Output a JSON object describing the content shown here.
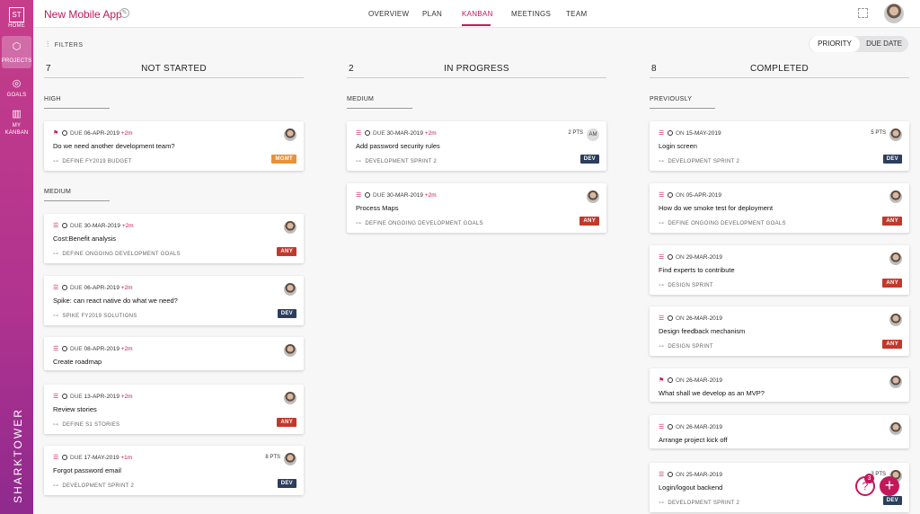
{
  "sidebar": {
    "logo": "ST",
    "home": "HOME",
    "projects": "PROJECTS",
    "goals": "GOALS",
    "my_kanban_1": "MY",
    "my_kanban_2": "KANBAN",
    "brand": "SHARKTOWER"
  },
  "topbar": {
    "title": "New Mobile App",
    "nav": [
      "OVERVIEW",
      "PLAN",
      "KANBAN",
      "MEETINGS",
      "TEAM"
    ]
  },
  "toolbar": {
    "filters": "FILTERS",
    "sort_priority": "PRIORITY",
    "sort_due": "DUE DATE"
  },
  "columns": [
    {
      "count": "7",
      "title": "NOT STARTED"
    },
    {
      "count": "2",
      "title": "IN PROGRESS"
    },
    {
      "count": "8",
      "title": "COMPLETED"
    }
  ],
  "groups": [
    "HIGH",
    "MEDIUM",
    "MEDIUM",
    "PREVIOUSLY"
  ],
  "colors": {
    "accent": "#c2185b",
    "mgmt": "#e8913a",
    "any": "#c0392b",
    "dev": "#2c3e5c"
  },
  "cards": [
    {
      "icon": "flag-icon",
      "prefix": "DUE",
      "date": "06-APR-2019",
      "delta": "+2m",
      "title": "Do we need another development team?",
      "goal": "DEFINE FY2019 BUDGET",
      "tag": "MGMT",
      "pts": ""
    },
    {
      "icon": "list-icon",
      "prefix": "DUE",
      "date": "30-MAR-2019",
      "delta": "+2m",
      "title": "Cost:Benefit analysis",
      "goal": "DEFINE ONGOING DEVELOPMENT GOALS",
      "tag": "ANY",
      "pts": ""
    },
    {
      "icon": "list-icon",
      "prefix": "DUE",
      "date": "06-APR-2019",
      "delta": "+2m",
      "title": "Spike: can react native do what we need?",
      "goal": "SPIKE FY2019 SOLUTIONS",
      "tag": "DEV",
      "pts": ""
    },
    {
      "icon": "list-icon",
      "prefix": "DUE",
      "date": "08-APR-2019",
      "delta": "+2m",
      "title": "Create roadmap",
      "goal": "",
      "tag": "",
      "pts": ""
    },
    {
      "icon": "list-icon",
      "prefix": "DUE",
      "date": "13-APR-2019",
      "delta": "+2m",
      "title": "Review stories",
      "goal": "DEFINE S1 STORIES",
      "tag": "ANY",
      "pts": ""
    },
    {
      "icon": "list-icon",
      "prefix": "DUE",
      "date": "17-MAY-2019",
      "delta": "+1m",
      "title": "Forgot password email",
      "goal": "DEVELOPMENT SPRINT 2",
      "tag": "DEV",
      "pts": "8 PTS"
    },
    {
      "icon": "list-icon",
      "prefix": "DUE",
      "date": "30-MAR-2019",
      "delta": "+2m",
      "title": "Add password security rules",
      "goal": "DEVELOPMENT SPRINT 2",
      "tag": "DEV",
      "pts": "2 PTS",
      "initials": "AM"
    },
    {
      "icon": "list-icon",
      "prefix": "DUE",
      "date": "30-MAR-2019",
      "delta": "+2m",
      "title": "Process Maps",
      "goal": "DEFINE ONGOING DEVELOPMENT GOALS",
      "tag": "ANY",
      "pts": ""
    },
    {
      "icon": "list-icon",
      "prefix": "ON",
      "date": "15-MAY-2019",
      "delta": "",
      "title": "Login screen",
      "goal": "DEVELOPMENT SPRINT 2",
      "tag": "DEV",
      "pts": "5 PTS"
    },
    {
      "icon": "list-icon",
      "prefix": "ON",
      "date": "05-APR-2019",
      "delta": "",
      "title": "How do we smoke test for deployment",
      "goal": "DEFINE ONGOING DEVELOPMENT GOALS",
      "tag": "ANY",
      "pts": ""
    },
    {
      "icon": "list-icon",
      "prefix": "ON",
      "date": "29-MAR-2019",
      "delta": "",
      "title": "Find experts to contribute",
      "goal": "DESIGN SPRINT",
      "tag": "ANY",
      "pts": ""
    },
    {
      "icon": "list-icon",
      "prefix": "ON",
      "date": "26-MAR-2019",
      "delta": "",
      "title": "Design feedback mechanism",
      "goal": "DESIGN SPRINT",
      "tag": "ANY",
      "pts": ""
    },
    {
      "icon": "flag-icon",
      "prefix": "ON",
      "date": "26-MAR-2019",
      "delta": "",
      "title": "What shall we develop as an MVP?",
      "goal": "",
      "tag": "",
      "pts": ""
    },
    {
      "icon": "list-icon",
      "prefix": "ON",
      "date": "26-MAR-2019",
      "delta": "",
      "title": "Arrange project kick off",
      "goal": "",
      "tag": "",
      "pts": ""
    },
    {
      "icon": "list-icon",
      "prefix": "ON",
      "date": "25-MAR-2019",
      "delta": "",
      "title": "Login/logout backend",
      "goal": "DEVELOPMENT SPRINT 2",
      "tag": "DEV",
      "pts": "3 PTS"
    }
  ],
  "help": {
    "badge": "3",
    "symbol": "?"
  },
  "fab": {
    "symbol": "+"
  }
}
